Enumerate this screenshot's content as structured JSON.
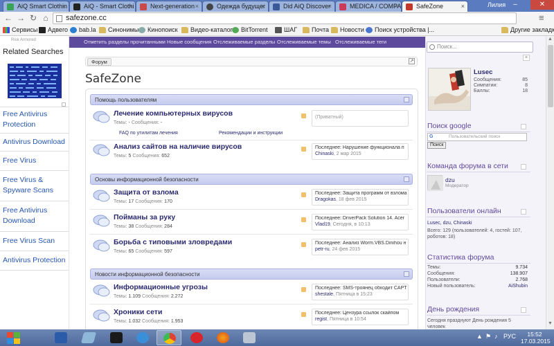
{
  "browser": {
    "tabs": [
      {
        "label": "AiQ Smart Clothin",
        "color": "#3aa35a"
      },
      {
        "label": "AiQ - Smart Clothi",
        "color": "#222222"
      },
      {
        "label": "Next-generation",
        "color": "#c84a4a"
      },
      {
        "label": "Одежда будущег",
        "color": "#444444"
      },
      {
        "label": "Did AiQ Discover",
        "color": "#3b5998"
      },
      {
        "label": "MEDICA / COMPA",
        "color": "#cc3a5a"
      },
      {
        "label": "SafeZone",
        "color": "#c0392b"
      }
    ],
    "window_user": "Лилия",
    "url": "safezone.cc",
    "bookmarks": [
      "Сервисы",
      "Адвего",
      "bab.la",
      "Синонимы",
      "Кинопоиск",
      "Видео-каталог",
      "BitTorrent",
      "ШАГ",
      "Почта",
      "Новости",
      "Поиск устройства |...",
      "Другие закладки"
    ]
  },
  "left_ad": {
    "ad_label": "Risk Armored",
    "related_title": "Related Searches",
    "links": [
      "Free Antivirus Protection",
      "Antivirus Download",
      "Free Virus",
      "Free Virus & Spyware Scans",
      "Free Antivirus Download",
      "Free Virus Scan",
      "Antivirus Protection"
    ]
  },
  "forum": {
    "nav": [
      "Отметить разделы прочитанными",
      "Новые сообщения",
      "Отслеживаемые разделы",
      "Отслеживаемые темы",
      "Отслеживаемые теги"
    ],
    "breadcrumb": "Форум",
    "site_title": "SafeZone",
    "categories": [
      {
        "title": "Помощь пользователям"
      },
      {
        "title": "Основы информационной безопасности"
      },
      {
        "title": "Новости информационной безопасности"
      }
    ],
    "forums": [
      {
        "title": "Лечение компьютерных вирусов",
        "topics_label": "Темы:",
        "topics": "-",
        "posts_label": "Сообщения:",
        "posts": "-",
        "last1": "(Приватный)",
        "last_user": "",
        "last_date": ""
      },
      {
        "title": "Анализ сайтов на наличие вирусов",
        "topics_label": "Темы:",
        "topics": "5",
        "posts_label": "Сообщения:",
        "posts": "652",
        "last1": "Последнее: Нарушение функционала п",
        "last_user": "Chinaski",
        "last_date": ", 2 мар 2015"
      },
      {
        "title": "Защита от взлома",
        "topics_label": "Темы:",
        "topics": "17",
        "posts_label": "Сообщения:",
        "posts": "170",
        "last1": "Последнее: Защита программ от взлома",
        "last_user": "Dragokas",
        "last_date": ", 18 фев 2015"
      },
      {
        "title": "Пойманы за руку",
        "topics_label": "Темы:",
        "topics": "38",
        "posts_label": "Сообщения:",
        "posts": "284",
        "last1": "Последнее: DriverPack Solution 14. Acer",
        "last_user": "Vlad19",
        "last_date": ", Сегодня, в 10:13"
      },
      {
        "title": "Борьба с типовыми зловредами",
        "topics_label": "Темы:",
        "topics": "65",
        "posts_label": "Сообщения:",
        "posts": "597",
        "last1": "Последнее: Анализ Worm.VBS.Dinihou н",
        "last_user": "petr-ru",
        "last_date": ", 24 фев 2015"
      },
      {
        "title": "Информационные угрозы",
        "topics_label": "Темы:",
        "topics": "1.109",
        "posts_label": "Сообщения:",
        "posts": "2.272",
        "last1": "Последнее: SMS-троянец обходит CAPT",
        "last_user": "shestale",
        "last_date": ", Пятница в 15:23"
      },
      {
        "title": "Хроники сети",
        "topics_label": "Темы:",
        "topics": "1.032",
        "posts_label": "Сообщения:",
        "posts": "1.953",
        "last1": "Последнее: Цензура ссылок скайпом",
        "last_user": "regist",
        "last_date": ", Пятница в 10:54"
      }
    ],
    "subforums": [
      "FAQ по утилитам лечения",
      "Рекомендации и инструкции"
    ]
  },
  "sidebar": {
    "search_placeholder": "Поиск...",
    "user": {
      "name": "Lusec",
      "stats": [
        {
          "label": "Сообщения:",
          "value": "85"
        },
        {
          "label": "Симпатии:",
          "value": "8"
        },
        {
          "label": "Баллы:",
          "value": "18"
        }
      ]
    },
    "google_title": "Поиск google",
    "google_placeholder": "Пользовательский поиск",
    "google_button": "Поиск",
    "staff_title": "Команда форума в сети",
    "staff_name": "dzu",
    "staff_role": "Модератор",
    "online_title": "Пользователи онлайн",
    "online_names": "Lusec, dzu, Chinaski",
    "online_counts": "Всего: 129 (пользователей: 4, гостей: 107, роботов: 18)",
    "stats_title": "Статистика форума",
    "stats": [
      {
        "label": "Темы:",
        "value": "9.734"
      },
      {
        "label": "Сообщения:",
        "value": "138.907"
      },
      {
        "label": "Пользователи:",
        "value": "2.768"
      },
      {
        "label": "Новый пользователь:",
        "value": "AiShubin"
      }
    ],
    "birthday_title": "День рождения",
    "birthday_text": "Сегодня празднуют День рождения 5 человек"
  },
  "taskbar": {
    "lang": "РУС",
    "time": "15:52",
    "date": "17.03.2015"
  },
  "colors": {
    "forum_nav": "#5e4a9c",
    "link": "#2455b2",
    "taskbar": "#5a76a8"
  }
}
